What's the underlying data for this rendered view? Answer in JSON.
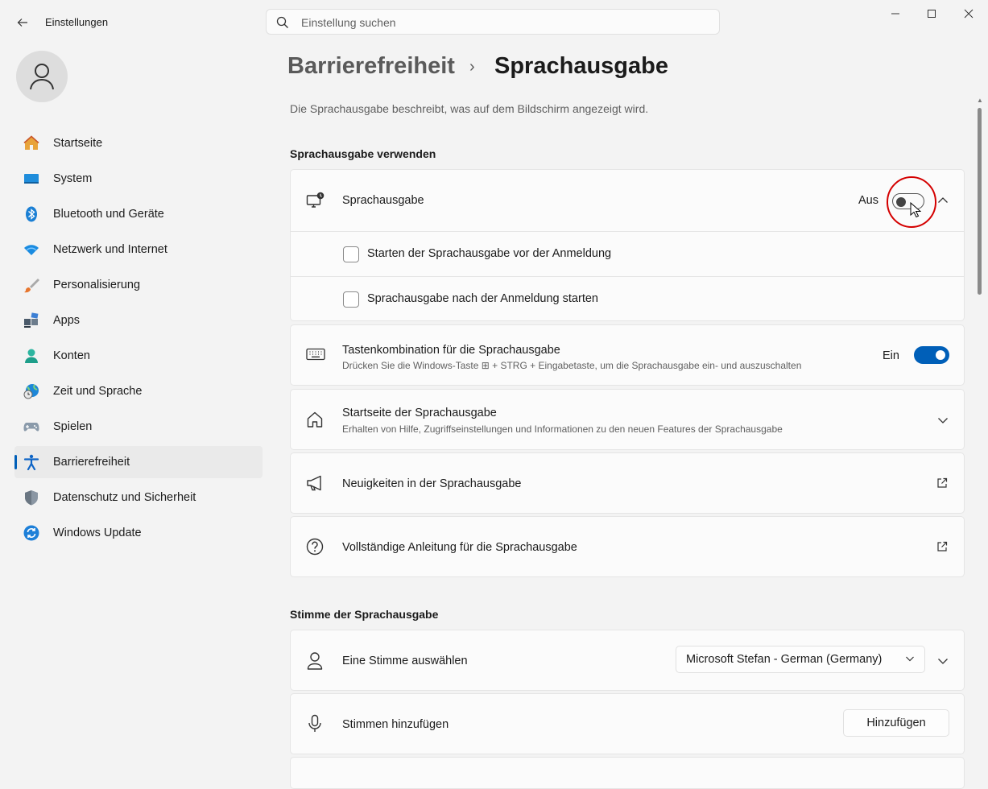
{
  "window": {
    "app_title": "Einstellungen",
    "search_placeholder": "Einstellung suchen",
    "controls": [
      "minimize",
      "maximize",
      "close"
    ]
  },
  "sidebar": {
    "items": [
      {
        "label": "Startseite",
        "icon": "home-icon"
      },
      {
        "label": "System",
        "icon": "system-icon"
      },
      {
        "label": "Bluetooth und Geräte",
        "icon": "bluetooth-icon"
      },
      {
        "label": "Netzwerk und Internet",
        "icon": "wifi-icon"
      },
      {
        "label": "Personalisierung",
        "icon": "brush-icon"
      },
      {
        "label": "Apps",
        "icon": "apps-icon"
      },
      {
        "label": "Konten",
        "icon": "account-icon"
      },
      {
        "label": "Zeit und Sprache",
        "icon": "time-language-icon"
      },
      {
        "label": "Spielen",
        "icon": "gamepad-icon"
      },
      {
        "label": "Barrierefreiheit",
        "icon": "accessibility-icon",
        "active": true
      },
      {
        "label": "Datenschutz und Sicherheit",
        "icon": "shield-icon"
      },
      {
        "label": "Windows Update",
        "icon": "update-icon"
      }
    ]
  },
  "header": {
    "breadcrumb_parent": "Barrierefreiheit",
    "breadcrumb_sep": "›",
    "title": "Sprachausgabe",
    "description": "Die Sprachausgabe beschreibt, was auf dem Bildschirm angezeigt wird."
  },
  "section1": {
    "heading": "Sprachausgabe verwenden",
    "narrator": {
      "title": "Sprachausgabe",
      "state": "Aus",
      "toggle_on": false,
      "expanded": true
    },
    "checkbox_before_login": {
      "label": "Starten der Sprachausgabe vor der Anmeldung",
      "checked": false
    },
    "checkbox_after_login": {
      "label": "Sprachausgabe nach der Anmeldung starten",
      "checked": false
    },
    "shortcut": {
      "title": "Tastenkombination für die Sprachausgabe",
      "subtitle": "Drücken Sie die Windows-Taste ⊞ + STRG + Eingabetaste, um die Sprachausgabe ein- und auszuschalten",
      "state": "Ein",
      "toggle_on": true
    },
    "home": {
      "title": "Startseite der Sprachausgabe",
      "subtitle": "Erhalten von Hilfe, Zugriffseinstellungen und Informationen zu den neuen Features der Sprachausgabe"
    },
    "news": {
      "title": "Neuigkeiten in der Sprachausgabe"
    },
    "guide": {
      "title": "Vollständige Anleitung für die Sprachausgabe"
    }
  },
  "section2": {
    "heading": "Stimme der Sprachausgabe",
    "voice": {
      "title": "Eine Stimme auswählen",
      "selected": "Microsoft Stefan - German (Germany)"
    },
    "add_voices": {
      "title": "Stimmen hinzufügen",
      "button": "Hinzufügen"
    }
  },
  "colors": {
    "accent": "#005fb8",
    "highlight_circle": "#d40000"
  }
}
